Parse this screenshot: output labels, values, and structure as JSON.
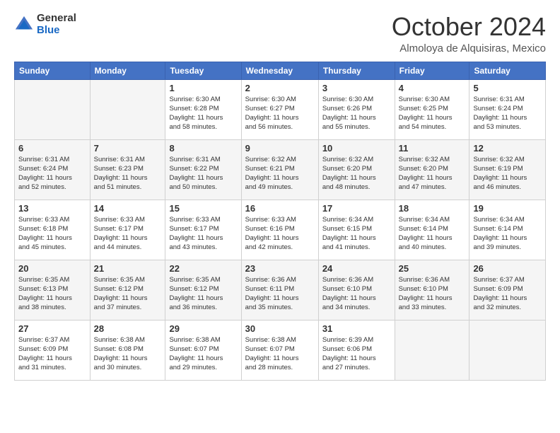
{
  "logo": {
    "general": "General",
    "blue": "Blue"
  },
  "header": {
    "month": "October 2024",
    "location": "Almoloya de Alquisiras, Mexico"
  },
  "weekdays": [
    "Sunday",
    "Monday",
    "Tuesday",
    "Wednesday",
    "Thursday",
    "Friday",
    "Saturday"
  ],
  "weeks": [
    [
      {
        "day": "",
        "info": ""
      },
      {
        "day": "",
        "info": ""
      },
      {
        "day": "1",
        "info": "Sunrise: 6:30 AM\nSunset: 6:28 PM\nDaylight: 11 hours\nand 58 minutes."
      },
      {
        "day": "2",
        "info": "Sunrise: 6:30 AM\nSunset: 6:27 PM\nDaylight: 11 hours\nand 56 minutes."
      },
      {
        "day": "3",
        "info": "Sunrise: 6:30 AM\nSunset: 6:26 PM\nDaylight: 11 hours\nand 55 minutes."
      },
      {
        "day": "4",
        "info": "Sunrise: 6:30 AM\nSunset: 6:25 PM\nDaylight: 11 hours\nand 54 minutes."
      },
      {
        "day": "5",
        "info": "Sunrise: 6:31 AM\nSunset: 6:24 PM\nDaylight: 11 hours\nand 53 minutes."
      }
    ],
    [
      {
        "day": "6",
        "info": "Sunrise: 6:31 AM\nSunset: 6:24 PM\nDaylight: 11 hours\nand 52 minutes."
      },
      {
        "day": "7",
        "info": "Sunrise: 6:31 AM\nSunset: 6:23 PM\nDaylight: 11 hours\nand 51 minutes."
      },
      {
        "day": "8",
        "info": "Sunrise: 6:31 AM\nSunset: 6:22 PM\nDaylight: 11 hours\nand 50 minutes."
      },
      {
        "day": "9",
        "info": "Sunrise: 6:32 AM\nSunset: 6:21 PM\nDaylight: 11 hours\nand 49 minutes."
      },
      {
        "day": "10",
        "info": "Sunrise: 6:32 AM\nSunset: 6:20 PM\nDaylight: 11 hours\nand 48 minutes."
      },
      {
        "day": "11",
        "info": "Sunrise: 6:32 AM\nSunset: 6:20 PM\nDaylight: 11 hours\nand 47 minutes."
      },
      {
        "day": "12",
        "info": "Sunrise: 6:32 AM\nSunset: 6:19 PM\nDaylight: 11 hours\nand 46 minutes."
      }
    ],
    [
      {
        "day": "13",
        "info": "Sunrise: 6:33 AM\nSunset: 6:18 PM\nDaylight: 11 hours\nand 45 minutes."
      },
      {
        "day": "14",
        "info": "Sunrise: 6:33 AM\nSunset: 6:17 PM\nDaylight: 11 hours\nand 44 minutes."
      },
      {
        "day": "15",
        "info": "Sunrise: 6:33 AM\nSunset: 6:17 PM\nDaylight: 11 hours\nand 43 minutes."
      },
      {
        "day": "16",
        "info": "Sunrise: 6:33 AM\nSunset: 6:16 PM\nDaylight: 11 hours\nand 42 minutes."
      },
      {
        "day": "17",
        "info": "Sunrise: 6:34 AM\nSunset: 6:15 PM\nDaylight: 11 hours\nand 41 minutes."
      },
      {
        "day": "18",
        "info": "Sunrise: 6:34 AM\nSunset: 6:14 PM\nDaylight: 11 hours\nand 40 minutes."
      },
      {
        "day": "19",
        "info": "Sunrise: 6:34 AM\nSunset: 6:14 PM\nDaylight: 11 hours\nand 39 minutes."
      }
    ],
    [
      {
        "day": "20",
        "info": "Sunrise: 6:35 AM\nSunset: 6:13 PM\nDaylight: 11 hours\nand 38 minutes."
      },
      {
        "day": "21",
        "info": "Sunrise: 6:35 AM\nSunset: 6:12 PM\nDaylight: 11 hours\nand 37 minutes."
      },
      {
        "day": "22",
        "info": "Sunrise: 6:35 AM\nSunset: 6:12 PM\nDaylight: 11 hours\nand 36 minutes."
      },
      {
        "day": "23",
        "info": "Sunrise: 6:36 AM\nSunset: 6:11 PM\nDaylight: 11 hours\nand 35 minutes."
      },
      {
        "day": "24",
        "info": "Sunrise: 6:36 AM\nSunset: 6:10 PM\nDaylight: 11 hours\nand 34 minutes."
      },
      {
        "day": "25",
        "info": "Sunrise: 6:36 AM\nSunset: 6:10 PM\nDaylight: 11 hours\nand 33 minutes."
      },
      {
        "day": "26",
        "info": "Sunrise: 6:37 AM\nSunset: 6:09 PM\nDaylight: 11 hours\nand 32 minutes."
      }
    ],
    [
      {
        "day": "27",
        "info": "Sunrise: 6:37 AM\nSunset: 6:09 PM\nDaylight: 11 hours\nand 31 minutes."
      },
      {
        "day": "28",
        "info": "Sunrise: 6:38 AM\nSunset: 6:08 PM\nDaylight: 11 hours\nand 30 minutes."
      },
      {
        "day": "29",
        "info": "Sunrise: 6:38 AM\nSunset: 6:07 PM\nDaylight: 11 hours\nand 29 minutes."
      },
      {
        "day": "30",
        "info": "Sunrise: 6:38 AM\nSunset: 6:07 PM\nDaylight: 11 hours\nand 28 minutes."
      },
      {
        "day": "31",
        "info": "Sunrise: 6:39 AM\nSunset: 6:06 PM\nDaylight: 11 hours\nand 27 minutes."
      },
      {
        "day": "",
        "info": ""
      },
      {
        "day": "",
        "info": ""
      }
    ]
  ]
}
